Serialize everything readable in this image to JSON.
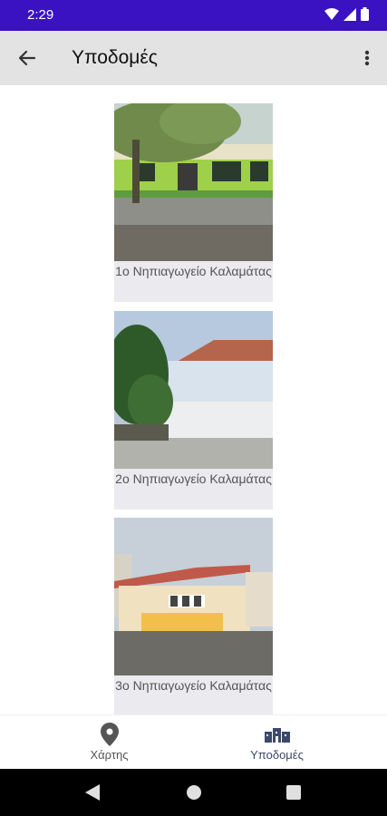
{
  "status": {
    "time": "2:29"
  },
  "appbar": {
    "title": "Υποδομές"
  },
  "cards": [
    {
      "label": "1ο Νηπιαγωγείο Καλαμάτας"
    },
    {
      "label": "2ο Νηπιαγωγείο Καλαμάτας"
    },
    {
      "label": "3ο Νηπιαγωγείο Καλαμάτας"
    }
  ],
  "bottom_nav": {
    "items": [
      {
        "label": "Χάρτης",
        "icon": "map-pin-icon",
        "active": false
      },
      {
        "label": "Υποδομές",
        "icon": "buildings-icon",
        "active": true
      }
    ]
  },
  "colors": {
    "status_bar": "#3a12c2",
    "active_nav": "#3b4a6b",
    "inactive_nav": "#555555"
  }
}
